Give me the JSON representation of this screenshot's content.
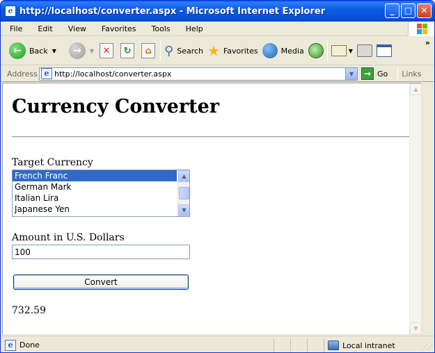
{
  "window": {
    "title": "http://localhost/converter.aspx - Microsoft Internet Explorer",
    "minimize_glyph": "_",
    "maximize_glyph": "□",
    "close_glyph": "✕"
  },
  "menu": [
    "File",
    "Edit",
    "View",
    "Favorites",
    "Tools",
    "Help"
  ],
  "toolbar": {
    "back_label": "Back",
    "search_label": "Search",
    "favorites_label": "Favorites",
    "media_label": "Media",
    "overflow": "»"
  },
  "address": {
    "label": "Address",
    "url": "http://localhost/converter.aspx",
    "go_label": "Go",
    "links_label": "Links"
  },
  "page": {
    "title": "Currency Converter",
    "target_label": "Target Currency",
    "currencies": [
      "French Franc",
      "German Mark",
      "Italian Lira",
      "Japanese Yen"
    ],
    "selected_currency": "French Franc",
    "amount_label": "Amount in U.S. Dollars",
    "amount_value": "100",
    "convert_label": "Convert",
    "result": "732.59"
  },
  "status": {
    "text": "Done",
    "zone": "Local intranet"
  },
  "colors": {
    "titlebar": "#0b5de6",
    "selection": "#316ac5",
    "chrome": "#ece9d8"
  }
}
